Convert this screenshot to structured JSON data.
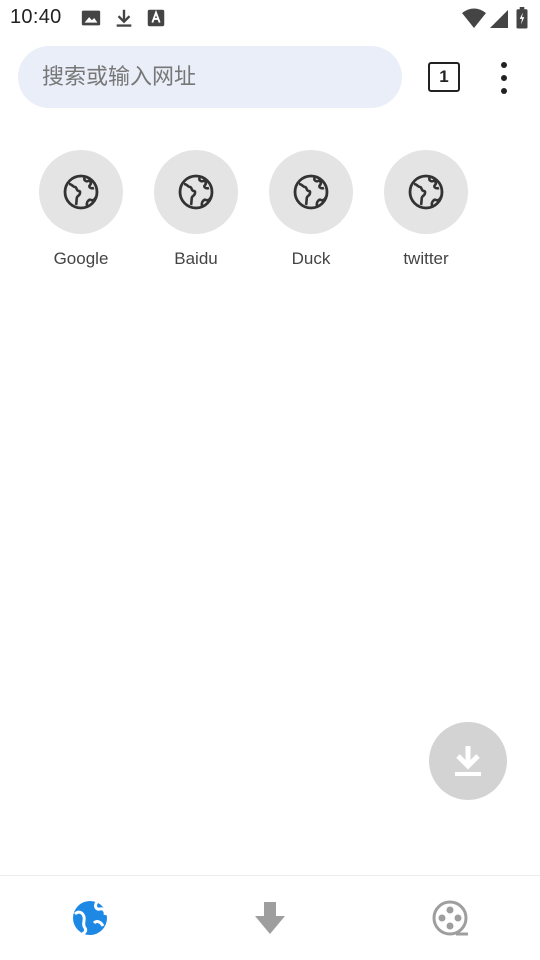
{
  "status_bar": {
    "time": "10:40",
    "left_icons": [
      "image-icon",
      "download-icon",
      "font-icon"
    ],
    "right_icons": [
      "wifi-icon",
      "signal-icon",
      "battery-icon"
    ]
  },
  "toolbar": {
    "search_placeholder": "搜索或输入网址",
    "tab_count": "1",
    "menu_icon": "more-vert-icon"
  },
  "shortcuts": [
    {
      "label": "Google",
      "icon": "globe-icon"
    },
    {
      "label": "Baidu",
      "icon": "globe-icon"
    },
    {
      "label": "Duck",
      "icon": "globe-icon"
    },
    {
      "label": "twitter",
      "icon": "globe-icon"
    }
  ],
  "fab": {
    "icon": "download-icon"
  },
  "bottom_nav": [
    {
      "icon": "globe-icon",
      "active": true
    },
    {
      "icon": "download-arrow-icon",
      "active": false
    },
    {
      "icon": "film-reel-icon",
      "active": false
    }
  ],
  "colors": {
    "accent": "#1e88e5",
    "search_bg": "#e9eef8",
    "shortcut_bg": "#e4e4e4",
    "fab_bg": "#d3d3d3",
    "inactive_icon": "#9e9e9e"
  }
}
